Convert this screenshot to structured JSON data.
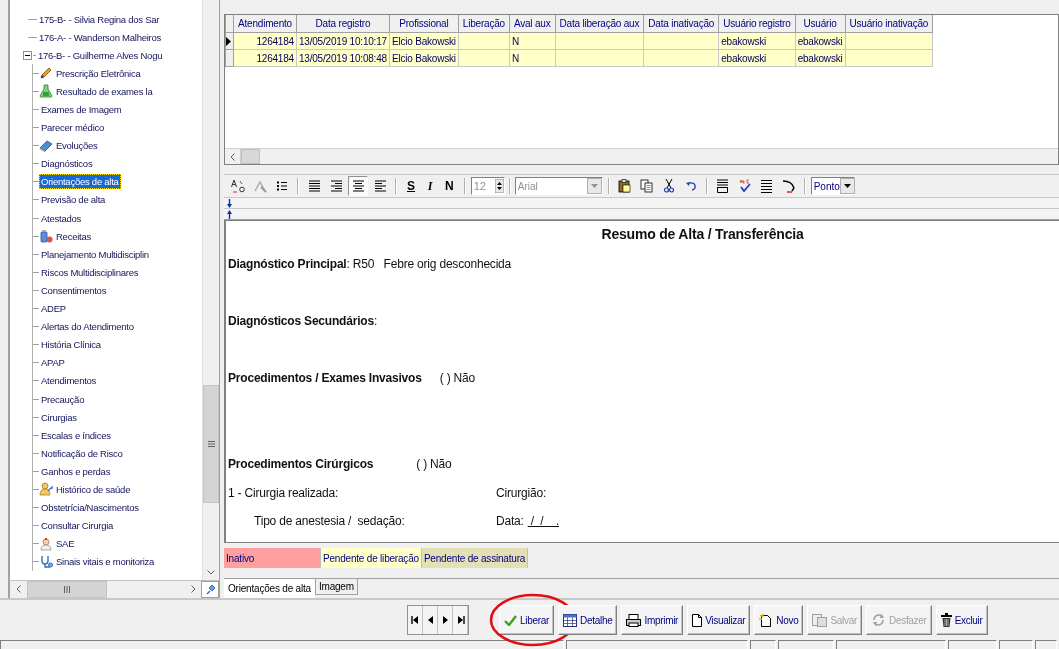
{
  "tree": {
    "items": [
      {
        "label": "175-B-  - Silvia Regina dos Sar"
      },
      {
        "label": "176-A-  - Wanderson Malheiros"
      },
      {
        "label": "176-B-  - Guilherme Alves Nogu",
        "children": [
          {
            "label": "Prescrição Eletrônica",
            "kind": "pencil",
            "selected": false
          },
          {
            "label": "Resultado de exames la",
            "kind": "flask",
            "selected": false
          },
          {
            "label": "Exames de Imagem",
            "kind": "plain",
            "selected": false
          },
          {
            "label": "Parecer médico",
            "kind": "plain",
            "selected": false
          },
          {
            "label": "Evoluções",
            "kind": "book",
            "selected": false
          },
          {
            "label": "Diagnósticos",
            "kind": "plain",
            "selected": false
          },
          {
            "label": "Orientações de alta",
            "kind": "plain",
            "selected": true
          },
          {
            "label": "Previsão de alta",
            "kind": "plain",
            "selected": false
          },
          {
            "label": "Atestados",
            "kind": "plain",
            "selected": false
          },
          {
            "label": "Receitas",
            "kind": "bottle",
            "selected": false
          },
          {
            "label": "Planejamento Multidisciplin",
            "kind": "plain",
            "selected": false
          },
          {
            "label": "Riscos Multidisciplinares",
            "kind": "plain",
            "selected": false
          },
          {
            "label": "Consentimentos",
            "kind": "plain",
            "selected": false
          },
          {
            "label": "ADEP",
            "kind": "plain",
            "selected": false
          },
          {
            "label": "Alertas do Atendimento",
            "kind": "plain",
            "selected": false
          },
          {
            "label": "História Clínica",
            "kind": "plain",
            "selected": false
          },
          {
            "label": "APAP",
            "kind": "plain",
            "selected": false
          },
          {
            "label": "Atendimentos",
            "kind": "plain",
            "selected": false
          },
          {
            "label": "Precaução",
            "kind": "plain",
            "selected": false
          },
          {
            "label": "Cirurgias",
            "kind": "plain",
            "selected": false
          },
          {
            "label": "Escalas e índices",
            "kind": "plain",
            "selected": false
          },
          {
            "label": "Notificação de Risco",
            "kind": "plain",
            "selected": false
          },
          {
            "label": "Ganhos e perdas",
            "kind": "plain",
            "selected": false
          },
          {
            "label": "Histórico de saúde",
            "kind": "person",
            "selected": false
          },
          {
            "label": "Obstetrícia/Nascimentos",
            "kind": "plain",
            "selected": false
          },
          {
            "label": "Consultar Cirurgia",
            "kind": "plain",
            "selected": false
          },
          {
            "label": "SAE",
            "kind": "nurse",
            "selected": false
          },
          {
            "label": "Sinais vitais e monitoriza",
            "kind": "stethoscope",
            "selected": false
          }
        ]
      }
    ]
  },
  "grid": {
    "columns": [
      "Atendimento",
      "Data registro",
      "Profissional",
      "Liberação",
      "Aval aux",
      "Data liberação aux",
      "Data inativação",
      "Usuário registro",
      "Usuário",
      "Usuário inativação"
    ],
    "rows": [
      {
        "selected": true,
        "color": "#ffffc8",
        "cells": [
          "1264184",
          "13/05/2019 10:10:17",
          "Elcio Bakowski",
          "",
          "N",
          "",
          "",
          "ebakowski",
          "ebakowski",
          ""
        ]
      },
      {
        "selected": false,
        "color": "#ffffc8",
        "cells": [
          "1264184",
          "13/05/2019 10:08:48",
          "Elcio Bakowski",
          "",
          "N",
          "",
          "",
          "ebakowski",
          "ebakowski",
          ""
        ]
      }
    ]
  },
  "editor_toolbar": {
    "align_buttons": [
      {
        "selected": false
      },
      {
        "selected": false
      },
      {
        "selected": true
      },
      {
        "selected": false
      }
    ],
    "style_buttons": [
      "S",
      "I",
      "N"
    ],
    "font_size": "12",
    "font": "Arial",
    "unit": "Ponto"
  },
  "document": {
    "title": "Resumo de Alta / Transferência",
    "lines": [
      {
        "kind": "text",
        "text": "**Diagnóstico Principal**: R50   Febre orig desconhecida"
      },
      {
        "kind": "text",
        "text": "**Diagnósticos Secundários**:"
      },
      {
        "kind": "option",
        "label": "Procedimentos / Exames Invasivos",
        "option": "( ) Não"
      },
      {
        "kind": "option",
        "label": "Procedimentos Cirúrgicos",
        "option": "( ) Não"
      },
      {
        "kind": "pair",
        "left": "1 - Cirurgia realizada:",
        "right": "Cirurgião:"
      },
      {
        "kind": "pair",
        "left": "Tipo de anestesia /  sedação:",
        "right": "Data:",
        "right_value": " /  /    ."
      }
    ]
  },
  "legend": [
    {
      "label": "Inativo",
      "color": "#ffa0a0"
    },
    {
      "label": "Pendente de liberação",
      "color": "#ffffc8"
    },
    {
      "label": "Pendente de assinatura",
      "color": "#e4dfb4"
    }
  ],
  "tabs": [
    {
      "label": "Orientações de alta",
      "selected": true
    },
    {
      "label": "Imagem",
      "selected": false
    }
  ],
  "actions": [
    {
      "label": "Liberar",
      "kind": "check",
      "disabled": false,
      "highlighted": true
    },
    {
      "label": "Detalhe",
      "kind": "table",
      "disabled": false,
      "highlighted": false
    },
    {
      "label": "Imprimir",
      "kind": "printer",
      "disabled": false,
      "highlighted": false
    },
    {
      "label": "Visualizar",
      "kind": "page",
      "disabled": false,
      "highlighted": false
    },
    {
      "label": "Novo",
      "kind": "new",
      "disabled": false,
      "highlighted": false
    },
    {
      "label": "Salvar",
      "kind": "save",
      "disabled": true,
      "highlighted": false
    },
    {
      "label": "Desfazer",
      "kind": "undo",
      "disabled": true,
      "highlighted": false
    },
    {
      "label": "Excluir",
      "kind": "trash",
      "disabled": false,
      "highlighted": false
    }
  ]
}
